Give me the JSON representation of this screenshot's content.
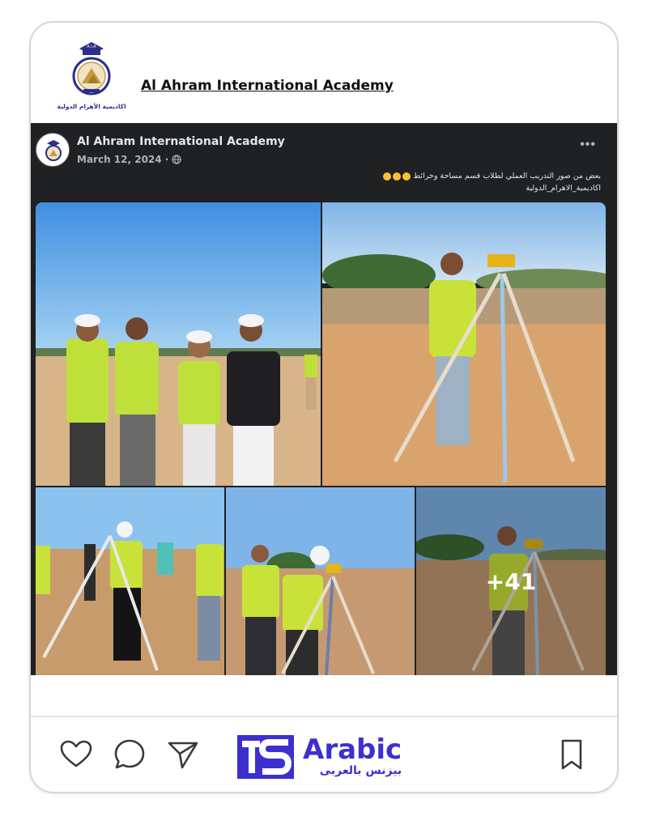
{
  "header": {
    "title": "Al Ahram International Academy",
    "logo": {
      "badge_text": "A.I.A",
      "arabic_name": "اكاديمية الأهرام الدولية"
    }
  },
  "post": {
    "page_name": "Al Ahram International Academy",
    "date": "March 12, 2024 ·",
    "privacy_icon": "globe-icon",
    "more_label": "•••",
    "caption_line1": "بعض من صور التدريب العملي لطلاب قسم مساحة وخرائط",
    "caption_line2": "اكاديمية_الاهرام_الدولية",
    "more_photos_count": "+41"
  },
  "footer": {
    "icons": [
      "heart-icon",
      "comment-icon",
      "send-icon",
      "bookmark-icon"
    ],
    "brand": {
      "name_en": "Arabic",
      "name_ar": "بيزنس بالعربى",
      "color": "#3d2fcf"
    }
  }
}
